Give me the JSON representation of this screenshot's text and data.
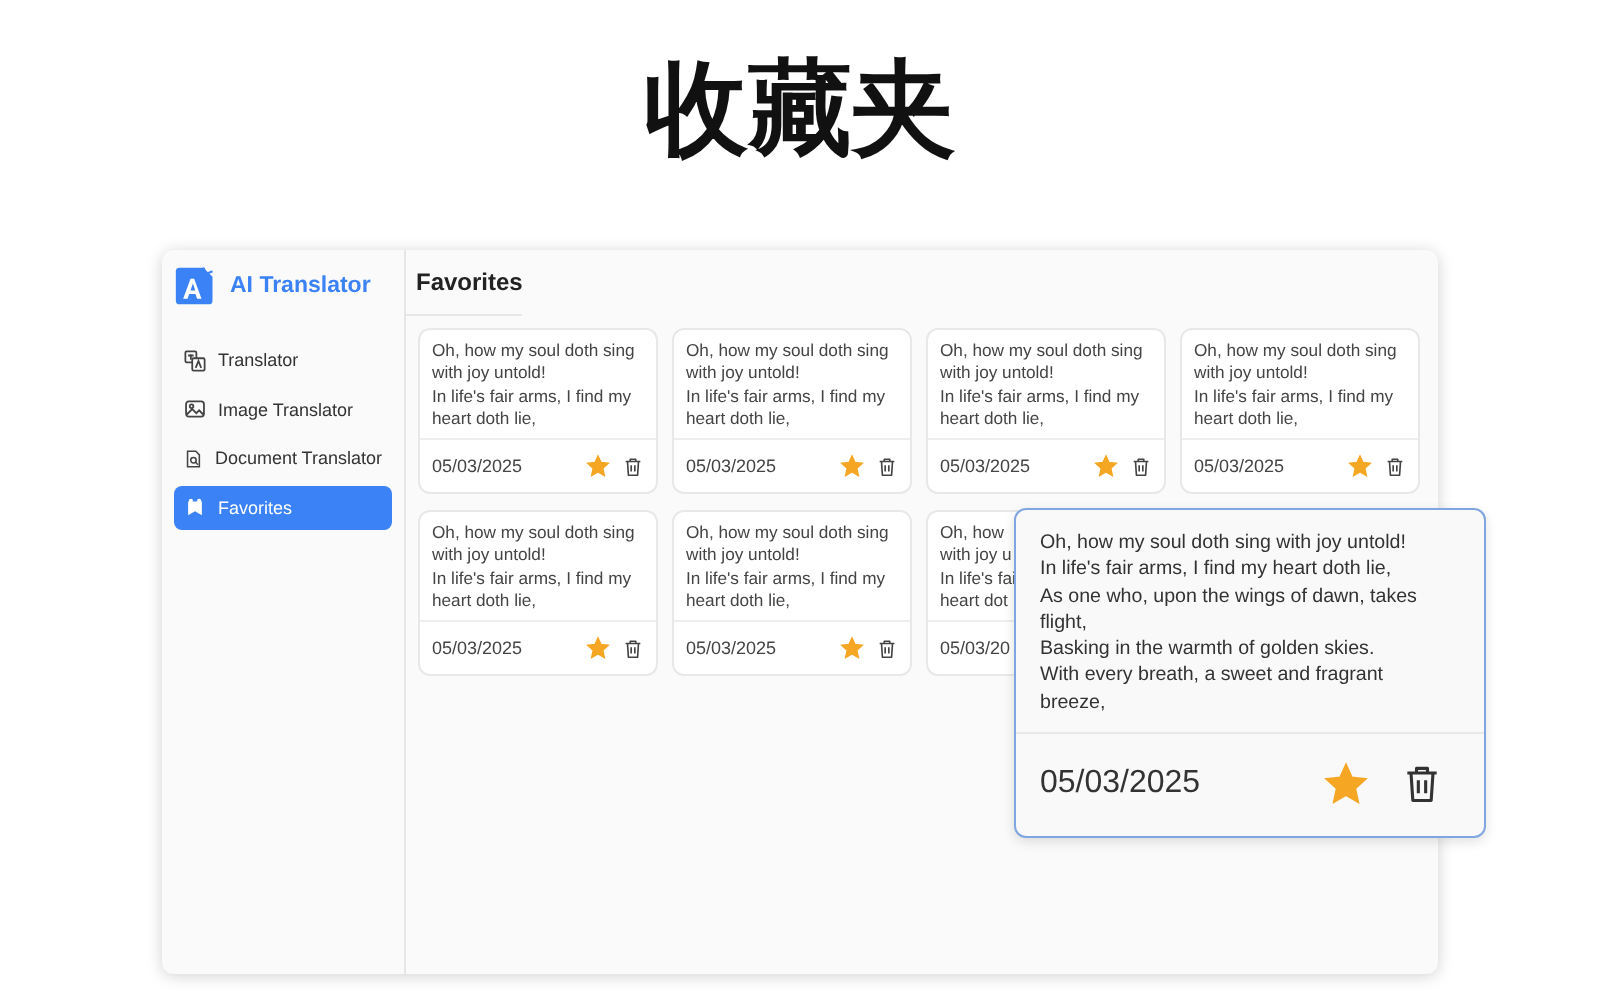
{
  "page_title": "收藏夹",
  "app": {
    "name": "AI Translator"
  },
  "sidebar": {
    "items": [
      {
        "label": "Translator",
        "selected": false
      },
      {
        "label": "Image Translator",
        "selected": false
      },
      {
        "label": "Document Translator",
        "selected": false
      },
      {
        "label": "Favorites",
        "selected": true
      }
    ]
  },
  "header": "Favorites",
  "cards": [
    {
      "lines": [
        "Oh, how my soul doth sing",
        "with joy untold!",
        "In life's fair arms, I find my",
        "heart doth lie,"
      ],
      "date": "05/03/2025",
      "starred": true
    },
    {
      "lines": [
        "Oh, how my soul doth sing",
        "with joy untold!",
        "In life's fair arms, I find my",
        "heart doth lie,"
      ],
      "date": "05/03/2025",
      "starred": true
    },
    {
      "lines": [
        "Oh, how my soul doth sing",
        "with joy untold!",
        "In life's fair arms, I find my",
        "heart doth lie,"
      ],
      "date": "05/03/2025",
      "starred": true
    },
    {
      "lines": [
        "Oh, how my soul doth sing",
        "with joy untold!",
        "In life's fair arms, I find my",
        "heart doth lie,"
      ],
      "date": "05/03/2025",
      "starred": true
    },
    {
      "lines": [
        "Oh, how my soul doth sing",
        "with joy untold!",
        "In life's fair arms, I find my",
        "heart doth lie,"
      ],
      "date": "05/03/2025",
      "starred": true
    },
    {
      "lines": [
        "Oh, how my soul doth sing",
        "with joy untold!",
        "In life's fair arms, I find my",
        "heart doth lie,"
      ],
      "date": "05/03/2025",
      "starred": true
    },
    {
      "lines": [
        "Oh, how",
        "with joy u",
        "In life's fai",
        "heart dot"
      ],
      "date": "05/03/20"
    }
  ],
  "expanded_card": {
    "lines": [
      "Oh, how my soul doth sing with joy untold!",
      "In life's fair arms, I find my heart doth lie,",
      "As one who, upon the wings of dawn, takes",
      "flight,",
      "Basking in the warmth of golden skies.",
      "With every breath, a sweet and fragrant",
      "breeze,"
    ],
    "date": "05/03/2025",
    "starred": true
  }
}
